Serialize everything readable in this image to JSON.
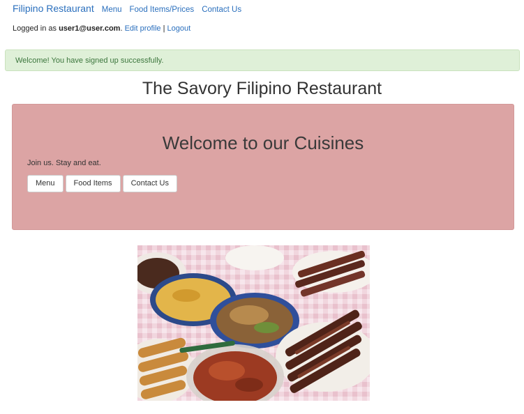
{
  "navbar": {
    "brand": "Filipino Restaurant",
    "links": [
      "Menu",
      "Food Items/Prices",
      "Contact Us"
    ]
  },
  "login": {
    "prefix": "Logged in as ",
    "user": "user1@user.com",
    "period": ".",
    "edit_profile": "Edit profile",
    "separator": "|",
    "logout": "Logout"
  },
  "alert": {
    "message": "Welcome! You have signed up successfully."
  },
  "page_title": "The Savory Filipino Restaurant",
  "jumbotron": {
    "heading": "Welcome to our Cuisines",
    "text": "Join us. Stay and eat.",
    "buttons": [
      "Menu",
      "Food Items",
      "Contact Us"
    ]
  },
  "colors": {
    "link": "#2a6fbd",
    "alert_bg": "#dff0d8",
    "alert_text": "#3c763d",
    "jumbotron_bg": "#dca4a4"
  },
  "image": {
    "subject": "filipino-food-spread"
  }
}
